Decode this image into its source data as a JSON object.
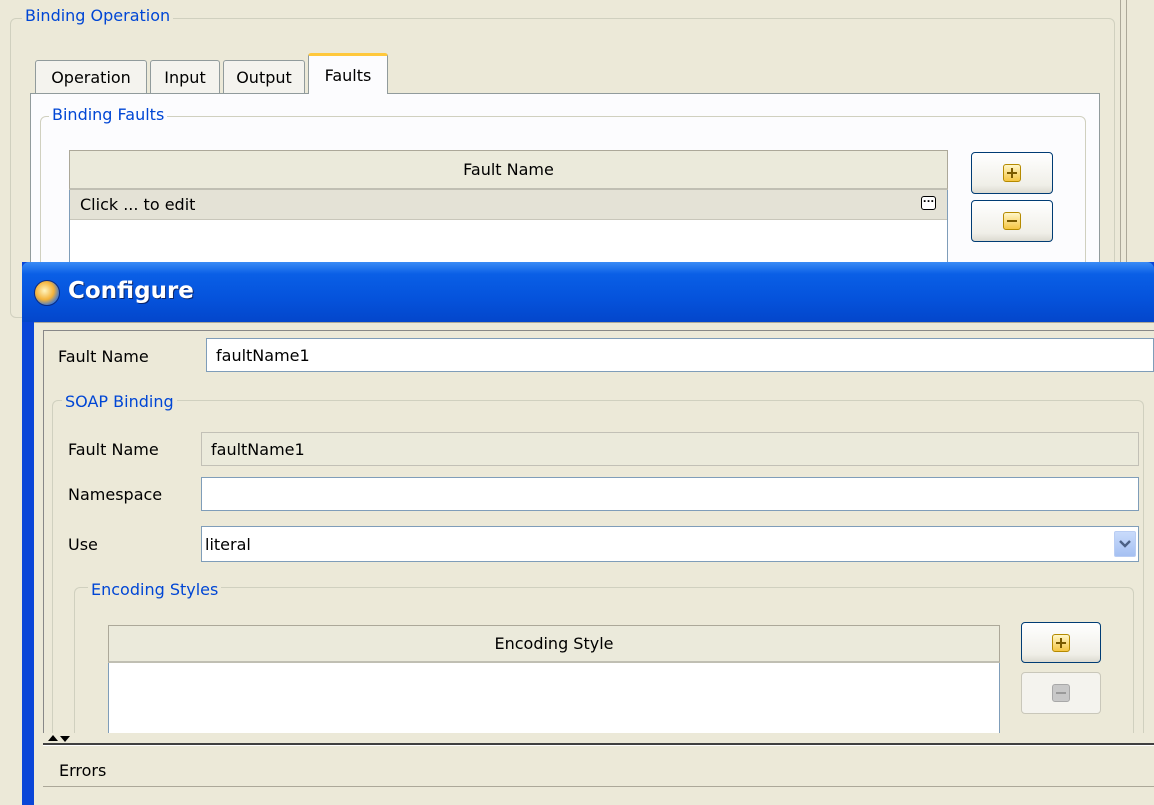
{
  "editor": {
    "group_title": "Binding Operation",
    "tabs": [
      {
        "label": "Operation"
      },
      {
        "label": "Input"
      },
      {
        "label": "Output"
      },
      {
        "label": "Faults",
        "active": true
      }
    ],
    "faults_group_title": "Binding Faults",
    "table": {
      "column_header": "Fault Name",
      "rows": [
        {
          "value": "Click ... to edit"
        }
      ]
    }
  },
  "dialog": {
    "title": "Configure",
    "fault_name_label": "Fault Name",
    "fault_name_value": "faultName1",
    "soap_group_title": "SOAP Binding",
    "soap": {
      "fault_name_label": "Fault Name",
      "fault_name_value": "faultName1",
      "namespace_label": "Namespace",
      "namespace_value": "",
      "use_label": "Use",
      "use_value": "literal"
    },
    "encoding_group_title": "Encoding Styles",
    "encoding_table": {
      "column_header": "Encoding Style",
      "rows": []
    },
    "errors_label": "Errors"
  },
  "icons": {
    "add": "add-icon",
    "remove": "remove-icon",
    "ellipsis": "ellipsis-icon",
    "dropdown": "chevron-down-icon",
    "app": "configure-app-icon"
  },
  "colors": {
    "title_bar": "#0553dc",
    "group_title": "#0046d5",
    "window_bg": "#ece9d8",
    "active_tab_highlight": "#ffc83c"
  }
}
